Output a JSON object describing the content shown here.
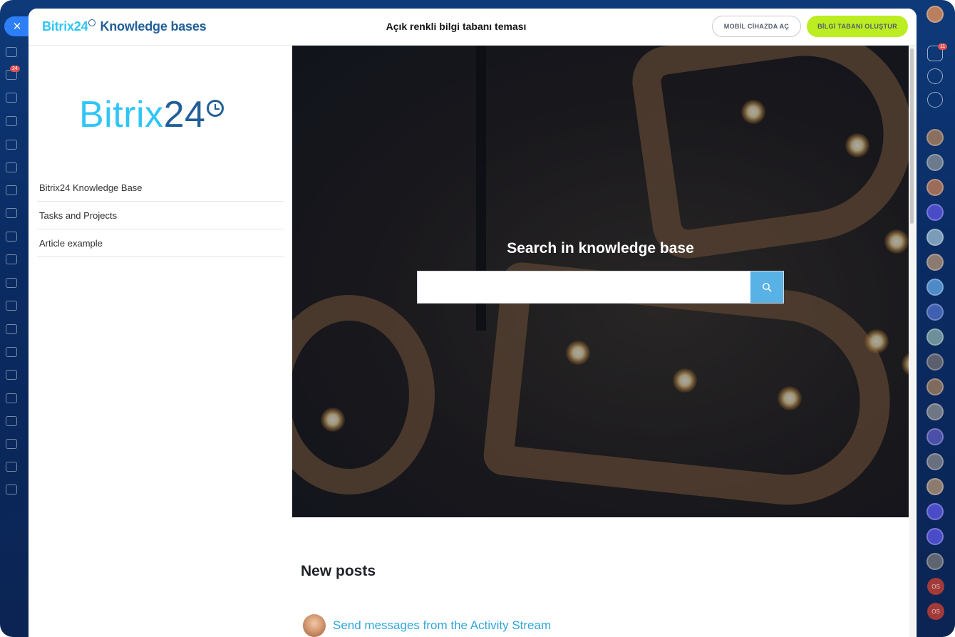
{
  "header": {
    "logo_brand": "Bitrix24",
    "logo_suffix": "Knowledge bases",
    "title": "Açık renkli bilgi tabanı teması",
    "mobile_button": "MOBİL CİHAZDA AÇ",
    "create_button": "BİLGİ TABANI OLUŞTUR"
  },
  "sidebar": {
    "logo_brand": "Bitrix",
    "logo_num": "24",
    "items": [
      {
        "label": "Bitrix24 Knowledge Base"
      },
      {
        "label": "Tasks and Projects"
      },
      {
        "label": "Article example"
      }
    ]
  },
  "hero": {
    "title": "Search in knowledge base",
    "search_value": "",
    "search_placeholder": ""
  },
  "posts": {
    "title": "New posts",
    "items": [
      {
        "title": "Send messages from the Activity Stream"
      }
    ]
  },
  "badges": {
    "left_rail_tasks": "24",
    "notifications": "11",
    "os_initials": "OS"
  },
  "colors": {
    "accent_blue": "#2fc6f6",
    "brand_dark": "#215f98",
    "create_button": "#bbed21",
    "search_button": "#59b2e5",
    "link": "#2fa6dc"
  }
}
